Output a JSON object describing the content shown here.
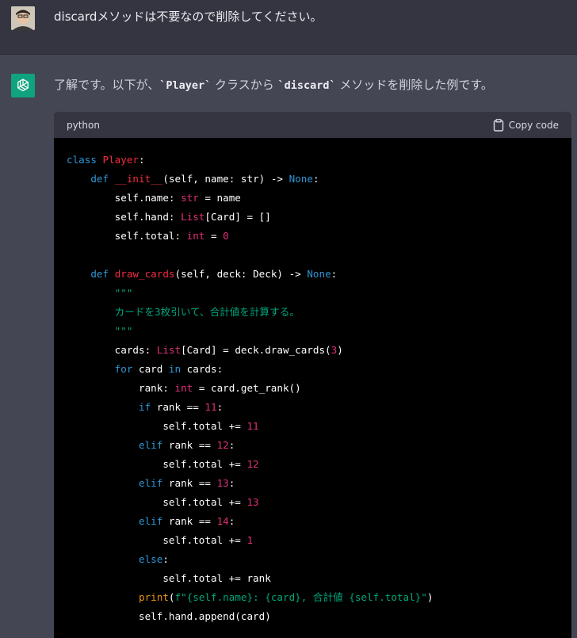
{
  "user_message": {
    "text": "discardメソッドは不要なので削除してください。"
  },
  "assistant_message": {
    "intro_prefix": "了解です。以下が、",
    "intro_code1": "`Player`",
    "intro_middle": " クラスから ",
    "intro_code2": "`discard`",
    "intro_suffix": " メソッドを削除した例です。"
  },
  "code_block": {
    "language": "python",
    "copy_label": "Copy code"
  },
  "colors": {
    "user_bg": "#343541",
    "assistant_bg": "#444654",
    "gpt_green": "#10a37f",
    "code_bg": "#000000"
  }
}
